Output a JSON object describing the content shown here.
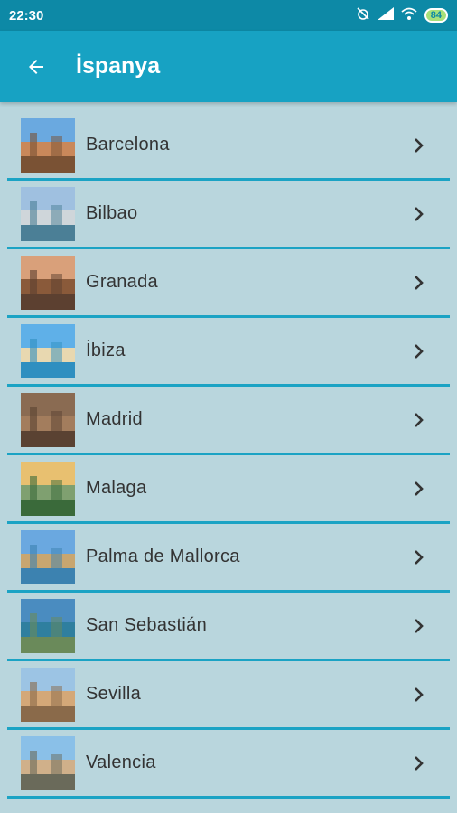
{
  "status_bar": {
    "time": "22:30",
    "battery": "84"
  },
  "app_bar": {
    "title": "İspanya"
  },
  "cities": [
    {
      "name": "Barcelona",
      "thumb_icon": "barcelona-thumbnail",
      "colors": [
        "#6aa9e0",
        "#c9885a",
        "#7a5234"
      ]
    },
    {
      "name": "Bilbao",
      "thumb_icon": "bilbao-thumbnail",
      "colors": [
        "#9fc0e0",
        "#cfd6da",
        "#4b7f96"
      ]
    },
    {
      "name": "Granada",
      "thumb_icon": "granada-thumbnail",
      "colors": [
        "#d9a07a",
        "#8a5a3a",
        "#5c4030"
      ]
    },
    {
      "name": "İbiza",
      "thumb_icon": "ibiza-thumbnail",
      "colors": [
        "#5fb0e8",
        "#e8d8b0",
        "#2f8fc0"
      ]
    },
    {
      "name": "Madrid",
      "thumb_icon": "madrid-thumbnail",
      "colors": [
        "#8a6b52",
        "#a37d5d",
        "#5a4232"
      ]
    },
    {
      "name": "Malaga",
      "thumb_icon": "malaga-thumbnail",
      "colors": [
        "#e8c070",
        "#7fa070",
        "#3a6a3a"
      ]
    },
    {
      "name": "Palma de Mallorca",
      "thumb_icon": "palma-thumbnail",
      "colors": [
        "#6aa8e0",
        "#c8a670",
        "#3c82b0"
      ]
    },
    {
      "name": "San Sebastián",
      "thumb_icon": "san-sebastian-thumbnail",
      "colors": [
        "#4a8cc0",
        "#2f7f9f",
        "#6a8a5a"
      ]
    },
    {
      "name": "Sevilla",
      "thumb_icon": "sevilla-thumbnail",
      "colors": [
        "#9cc4e4",
        "#d4a878",
        "#8a6a4a"
      ]
    },
    {
      "name": "Valencia",
      "thumb_icon": "valencia-thumbnail",
      "colors": [
        "#8ac0e8",
        "#d0b08a",
        "#6a6a5a"
      ]
    }
  ]
}
